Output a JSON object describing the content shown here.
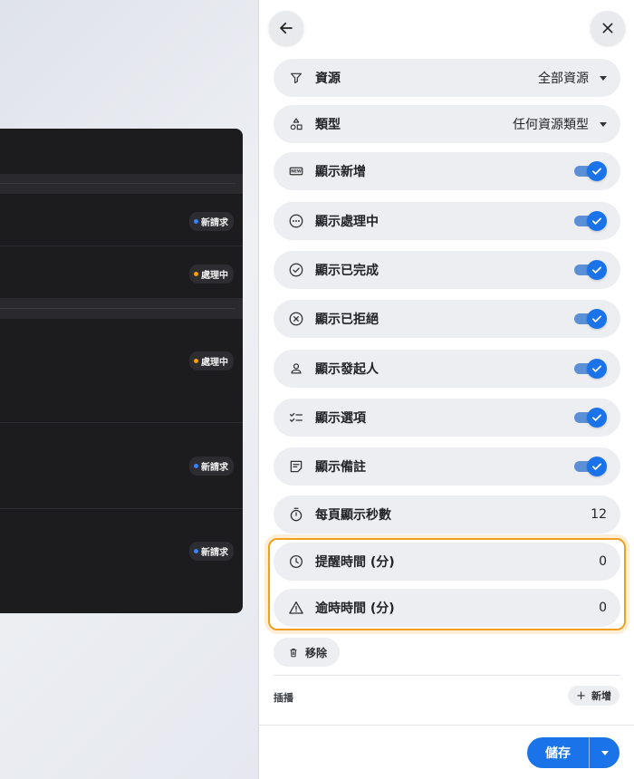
{
  "background_preview": {
    "badges": [
      {
        "label": "新請求",
        "dot_color": "#3b82f6"
      },
      {
        "label": "處理中",
        "dot_color": "#f59e0b"
      },
      {
        "label": "處理中",
        "dot_color": "#f59e0b"
      },
      {
        "label": "新請求",
        "dot_color": "#3b82f6"
      },
      {
        "label": "新請求",
        "dot_color": "#3b82f6"
      }
    ]
  },
  "panel": {
    "back_icon": "arrow-left-icon",
    "close_icon": "close-icon",
    "source": {
      "label": "資源",
      "value": "全部資源",
      "icon": "filter-icon"
    },
    "type": {
      "label": "類型",
      "value": "任何資源類型",
      "icon": "shapes-icon"
    },
    "toggles": [
      {
        "label": "顯示新增",
        "icon": "new-badge-icon",
        "checked": true
      },
      {
        "label": "顯示處理中",
        "icon": "more-circle-icon",
        "checked": true
      },
      {
        "label": "顯示已完成",
        "icon": "check-circle-icon",
        "checked": true
      },
      {
        "label": "顯示已拒絕",
        "icon": "x-circle-icon",
        "checked": true
      },
      {
        "label": "顯示發起人",
        "icon": "person-icon",
        "checked": true
      },
      {
        "label": "顯示選項",
        "icon": "checklist-icon",
        "checked": true
      },
      {
        "label": "顯示備註",
        "icon": "note-icon",
        "checked": true
      }
    ],
    "seconds_per_page": {
      "label": "每頁顯示秒數",
      "value": "12",
      "icon": "timer-icon"
    },
    "reminder": {
      "label": "提醒時間 (分)",
      "value": "0",
      "icon": "clock-icon"
    },
    "overdue": {
      "label": "逾時時間 (分)",
      "value": "0",
      "icon": "warning-icon"
    },
    "remove_label": "移除",
    "insert_label": "插播",
    "add_label": "新增",
    "save_label": "儲存",
    "accent_color": "#1a73e8",
    "highlight_color": "#f0a020"
  }
}
